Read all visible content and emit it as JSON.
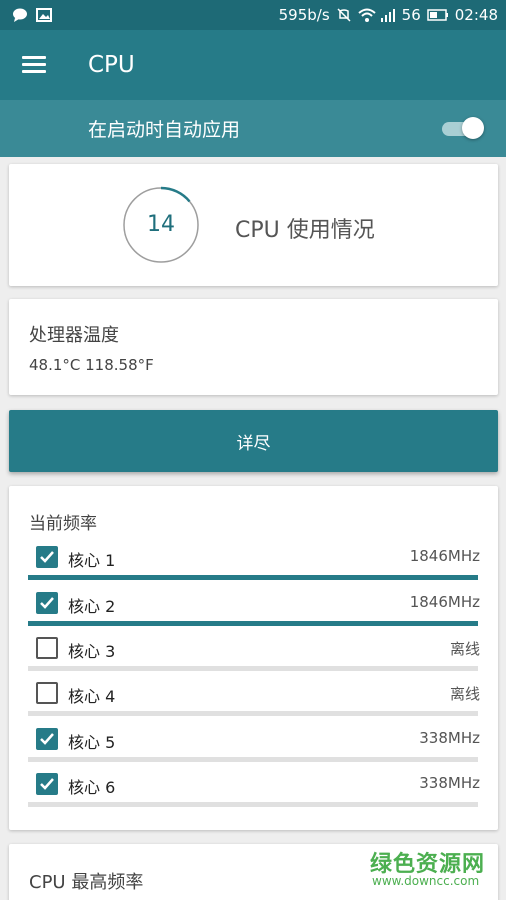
{
  "status_bar": {
    "net_speed": "595b/s",
    "signal_text": "56",
    "time": "02:48"
  },
  "app_bar": {
    "title": "CPU",
    "menu_icon": "hamburger-menu-icon"
  },
  "auto_apply": {
    "label": "在启动时自动应用",
    "enabled": true
  },
  "cpu_usage": {
    "value": "14",
    "label": "CPU 使用情况",
    "percent": 14
  },
  "temperature": {
    "title": "处理器温度",
    "value": "48.1°C 118.58°F"
  },
  "details_button": {
    "label": "详尽"
  },
  "frequency": {
    "title": "当前频率",
    "cores": [
      {
        "label": "核心 1",
        "freq": "1846MHz",
        "checked": true,
        "level": 1.0
      },
      {
        "label": "核心 2",
        "freq": "1846MHz",
        "checked": true,
        "level": 1.0
      },
      {
        "label": "核心 3",
        "freq": "离线",
        "checked": false,
        "level": 0
      },
      {
        "label": "核心 4",
        "freq": "离线",
        "checked": false,
        "level": 0
      },
      {
        "label": "核心 5",
        "freq": "338MHz",
        "checked": true,
        "level": 0
      },
      {
        "label": "核心 6",
        "freq": "338MHz",
        "checked": true,
        "level": 0
      }
    ]
  },
  "max_frequency": {
    "title": "CPU 最高频率"
  },
  "watermark": {
    "main": "绿色资源网",
    "sub": "www.downcc.com"
  },
  "colors": {
    "primary": "#267b88",
    "status_bar": "#1e6a76",
    "accent": "#3a8a96"
  }
}
